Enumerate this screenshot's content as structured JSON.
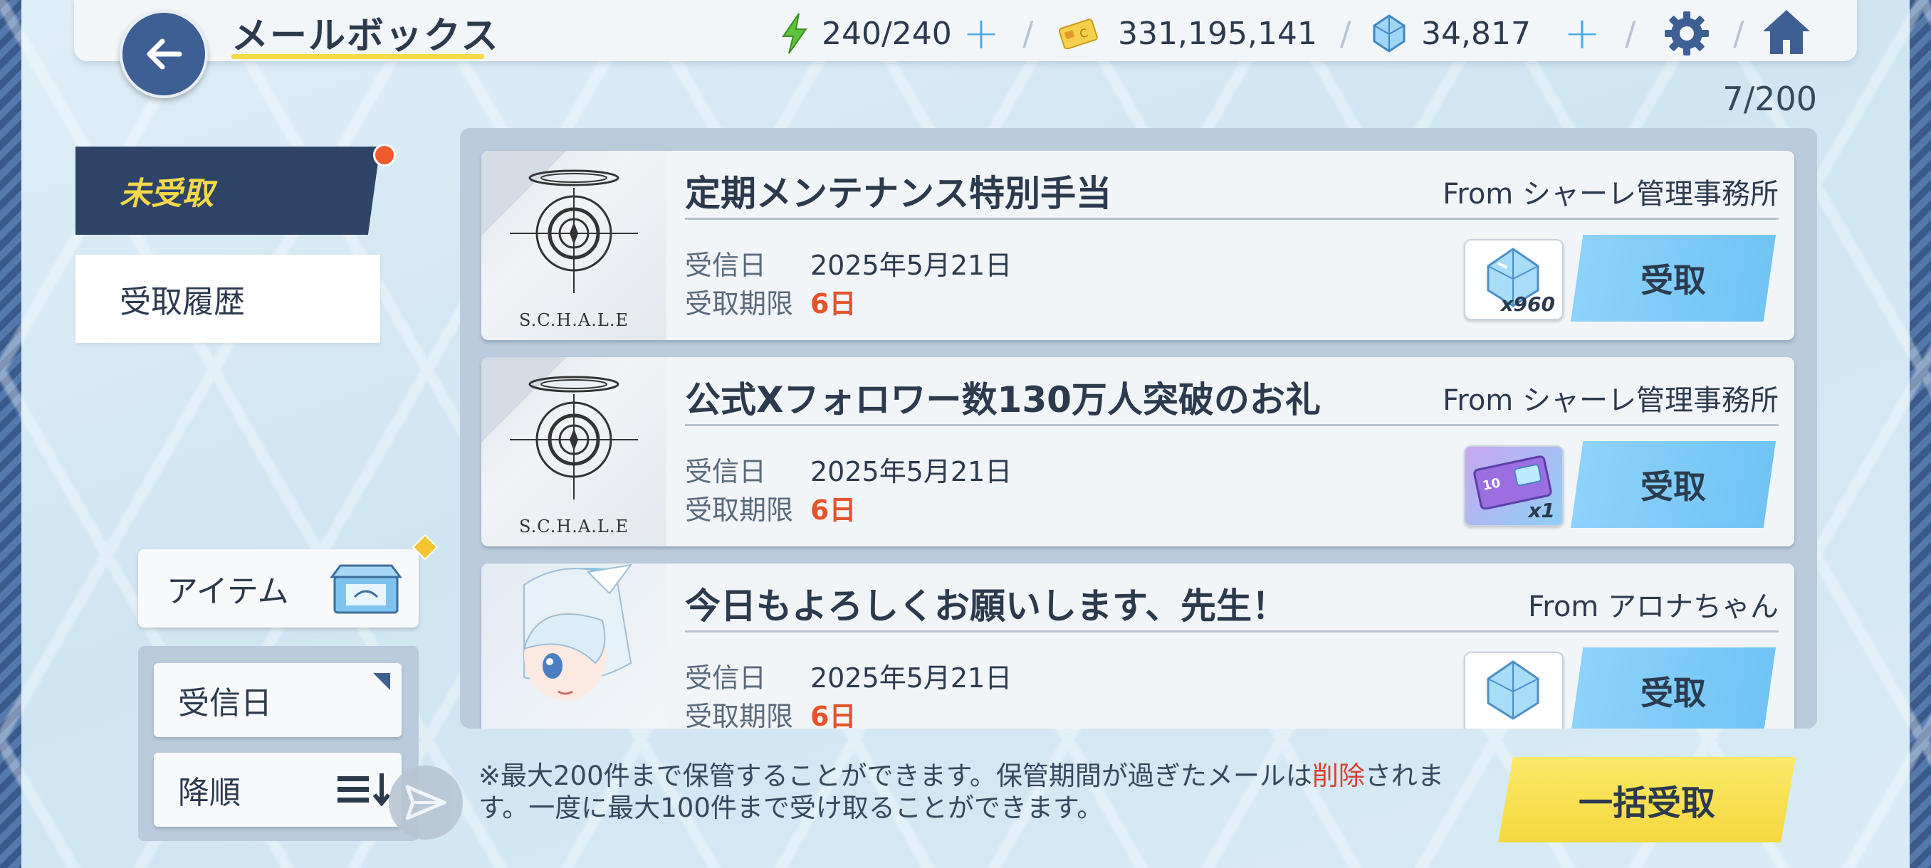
{
  "header": {
    "title": "メールボックス",
    "stamina": "240/240",
    "credits": "331,195,141",
    "pyroxene": "34,817"
  },
  "mail_count": "7/200",
  "tabs": [
    {
      "label": "未受取",
      "active": true
    },
    {
      "label": "受取履歴",
      "active": false
    }
  ],
  "filter": {
    "category_label": "アイテム",
    "sort_label": "受信日",
    "order_label": "降順"
  },
  "mail_labels": {
    "received": "受信日",
    "deadline": "受取期限",
    "claim_button": "受取"
  },
  "mails": [
    {
      "title": "定期メンテナンス特別手当",
      "from": "From シャーレ管理事務所",
      "received_date": "2025年5月21日",
      "deadline": "6日",
      "reward_icon": "pyroxene-icon",
      "reward_qty": "x960",
      "thumb_text": "S.C.H.A.L.E"
    },
    {
      "title": "公式Xフォロワー数130万人突破のお礼",
      "from": "From シャーレ管理事務所",
      "received_date": "2025年5月21日",
      "deadline": "6日",
      "reward_icon": "ticket-icon",
      "reward_qty": "x1",
      "thumb_text": "S.C.H.A.L.E"
    },
    {
      "title": "今日もよろしくお願いします、先生！",
      "from": "From アロナちゃん",
      "received_date": "2025年5月21日",
      "deadline": "6日",
      "reward_icon": "pyroxene-icon",
      "reward_qty": ""
    }
  ],
  "footer": {
    "note_part1": "※最大200件まで保管することができます。保管期間が過ぎたメールは",
    "note_red": "削除",
    "note_part2": "されます。一度に最大100件まで受け取ることができます。",
    "bulk_button": "一括受取"
  },
  "colors": {
    "accent_blue": "#6fc3f4",
    "accent_yellow": "#f4d83e",
    "dark_navy": "#2e4467",
    "deadline_red": "#e5532a"
  }
}
